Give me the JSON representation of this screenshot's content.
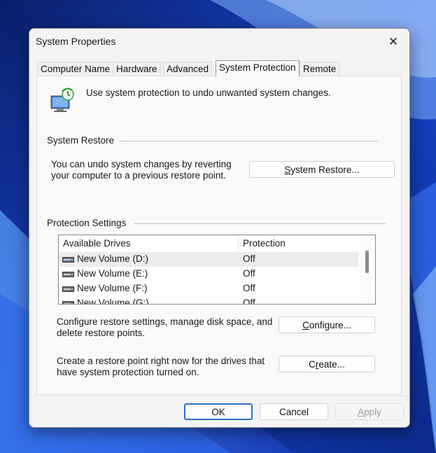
{
  "window": {
    "title": "System Properties"
  },
  "tabs": [
    {
      "label": "Computer Name"
    },
    {
      "label": "Hardware"
    },
    {
      "label": "Advanced"
    },
    {
      "label": "System Protection",
      "active": true
    },
    {
      "label": "Remote"
    }
  ],
  "intro": {
    "text": "Use system protection to undo unwanted system changes."
  },
  "system_restore": {
    "heading": "System Restore",
    "desc_line1": "You can undo system changes by reverting",
    "desc_line2": "your computer to a previous restore point.",
    "button_prefix": "",
    "button_mnemonic": "S",
    "button_rest": "ystem Restore..."
  },
  "protection": {
    "heading": "Protection Settings",
    "columns": {
      "drives": "Available Drives",
      "protection": "Protection"
    },
    "drives": [
      {
        "name": "New Volume (D:)",
        "protection": "Off",
        "selected": true
      },
      {
        "name": "New Volume (E:)",
        "protection": "Off"
      },
      {
        "name": "New Volume (F:)",
        "protection": "Off"
      },
      {
        "name": "New Volume (G:)",
        "protection": "Off"
      }
    ],
    "configure_line1": "Configure restore settings, manage disk space, and",
    "configure_line2": "delete restore points.",
    "configure_mnemonic": "C",
    "configure_rest": "onfigure...",
    "create_line1": "Create a restore point right now for the drives that",
    "create_line2": "have system protection turned on.",
    "create_prefix": "C",
    "create_mnemonic": "r",
    "create_rest": "eate..."
  },
  "footer": {
    "ok": "OK",
    "cancel": "Cancel",
    "apply_mnemonic": "A",
    "apply_rest": "pply"
  },
  "colors": {
    "accent": "#2a6fc9",
    "wallpaper": "#0a2a8f"
  }
}
